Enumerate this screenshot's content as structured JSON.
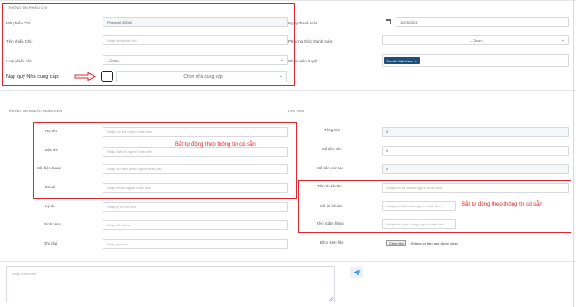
{
  "info": {
    "section_title": "THÔNG TIN PHIẾU CHI",
    "ma_phieu_chi_label": "Mã phiếu Chi:",
    "ma_phieu_chi_value": "Phieuchi_00067",
    "ten_phieu_chi_label": "Tên phiếu Chi:",
    "ten_phieu_chi_placeholder": "Nhập tên phiếu chi",
    "loai_phieu_chi_label": "Loại phiếu chi:",
    "loai_phieu_chi_value": "--Chọn--",
    "ngay_thanh_toan_label": "Ngày thanh toán:",
    "ngay_thanh_toan_value": "12/09/2023",
    "pttt_label": "Phương thức thanh toán:",
    "pttt_value": "-- Chọn --",
    "nhan_vien_label": "Nhân viên duyệt:",
    "nhan_vien_tag": "Tourkit Việt Nam",
    "nap_quy_label": "Nạp quỹ Nhà cung cấp:",
    "chon_ncc_value": "Chọn nhà cung cấp"
  },
  "nguoi_nhan": {
    "section_title": "THÔNG TIN NGƯỜI NHẬN TIỀN",
    "ho_ten_label": "Họ tên",
    "ho_ten_placeholder": "Nhập họ tên người nhận tiền",
    "dia_chi_label": "Địa chỉ",
    "dia_chi_placeholder": "Nhập địa chỉ người nhận tiền",
    "sdt_label": "Số điện thoại",
    "sdt_placeholder": "Nhập số điện thoại người nhận tiền",
    "email_label": "Email",
    "email_placeholder": "Nhập email người nhận tiền",
    "ly_do_label": "Lý do",
    "ly_do_placeholder": "Nhập lý do chi tiền",
    "dinh_kem_label": "Đính kèm",
    "dinh_kem_placeholder": "Nhập đính kèm",
    "ghi_chu_label": "Ghi chú",
    "ghi_chu_placeholder": "Nhập ghi chú"
  },
  "chi_tien": {
    "section_title": "CHI TIỀN",
    "tong_tien_label": "Tổng tiền",
    "tong_tien_value": "0",
    "so_tien_chi_label": "Số tiền Chi",
    "so_tien_chi_value": "0",
    "so_tien_con_lai_label": "Số tiền còn lại",
    "so_tien_con_lai_value": "0",
    "ten_tk_label": "Tên tài khoản",
    "ten_tk_placeholder": "Nhập tên tài khoản người nhận tiền",
    "so_tk_label": "Số tài khoản",
    "so_tk_placeholder": "Nhập số tài khoản người nhận tiền",
    "ngan_hang_label": "Tên ngân hàng",
    "ngan_hang_placeholder": "Nhập tên ngân hàng người nhận tiền",
    "file_label": "Đính kèm file",
    "file_button": "Chọn tệp",
    "file_status": "Không có tệp nào được chọn"
  },
  "comment": {
    "placeholder": "Nhập comment"
  },
  "annotations": {
    "auto_fill_left": "Bắt tự động theo thông tin có sẵn",
    "auto_fill_right": "Bắt tự động theo thông tin có sẵn"
  },
  "colors": {
    "annotation_red": "#e0272f",
    "tag_bg": "#1f4e79",
    "send_blue": "#2e86de"
  }
}
